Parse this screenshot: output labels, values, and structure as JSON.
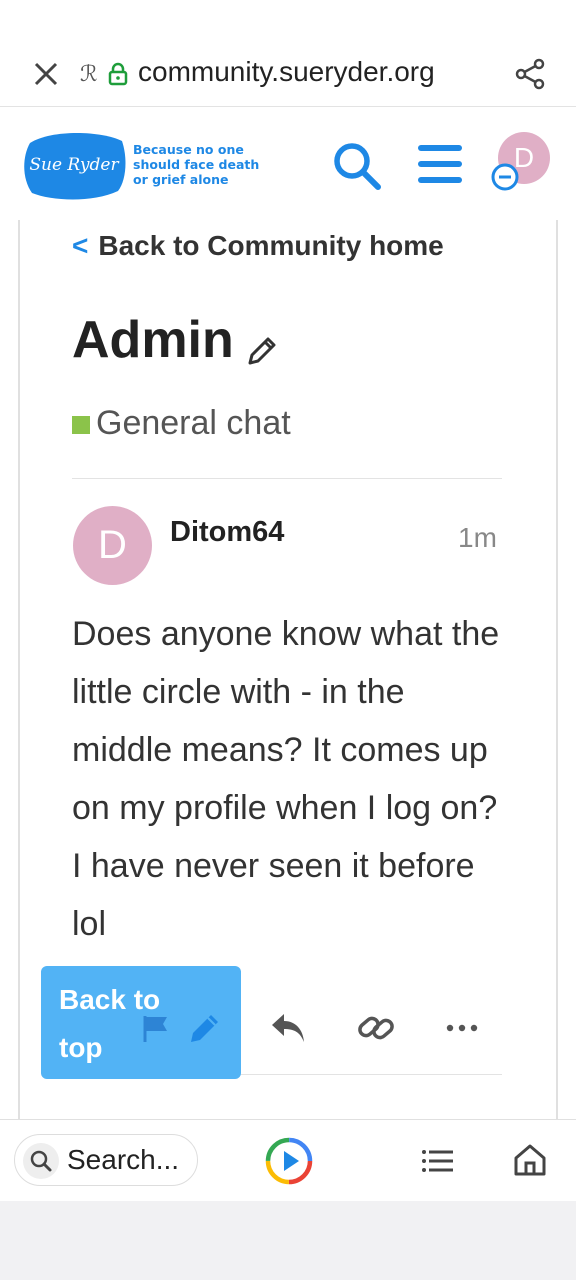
{
  "browser": {
    "url": "community.sueryder.org"
  },
  "header": {
    "logo_text": "Sue Ryder",
    "tagline": [
      "Because no one",
      "should face death",
      "or grief alone"
    ],
    "avatar_initial": "D"
  },
  "topic": {
    "back_link": "Back to Community home",
    "title": "Admin",
    "category": "General chat",
    "category_color": "#8bc34a"
  },
  "post": {
    "avatar_initial": "D",
    "username": "Ditom64",
    "time": "1m",
    "body": "Does anyone know what the little circle with - in the middle means? It comes up on my profile when I log on? I have never seen it before lol"
  },
  "back_to_top": "Back to top",
  "bottom": {
    "search_placeholder": "Search..."
  },
  "colors": {
    "accent": "#1e88e5",
    "avatar": "#e0afc6",
    "back_to_top_bg": "#52b3f5"
  }
}
